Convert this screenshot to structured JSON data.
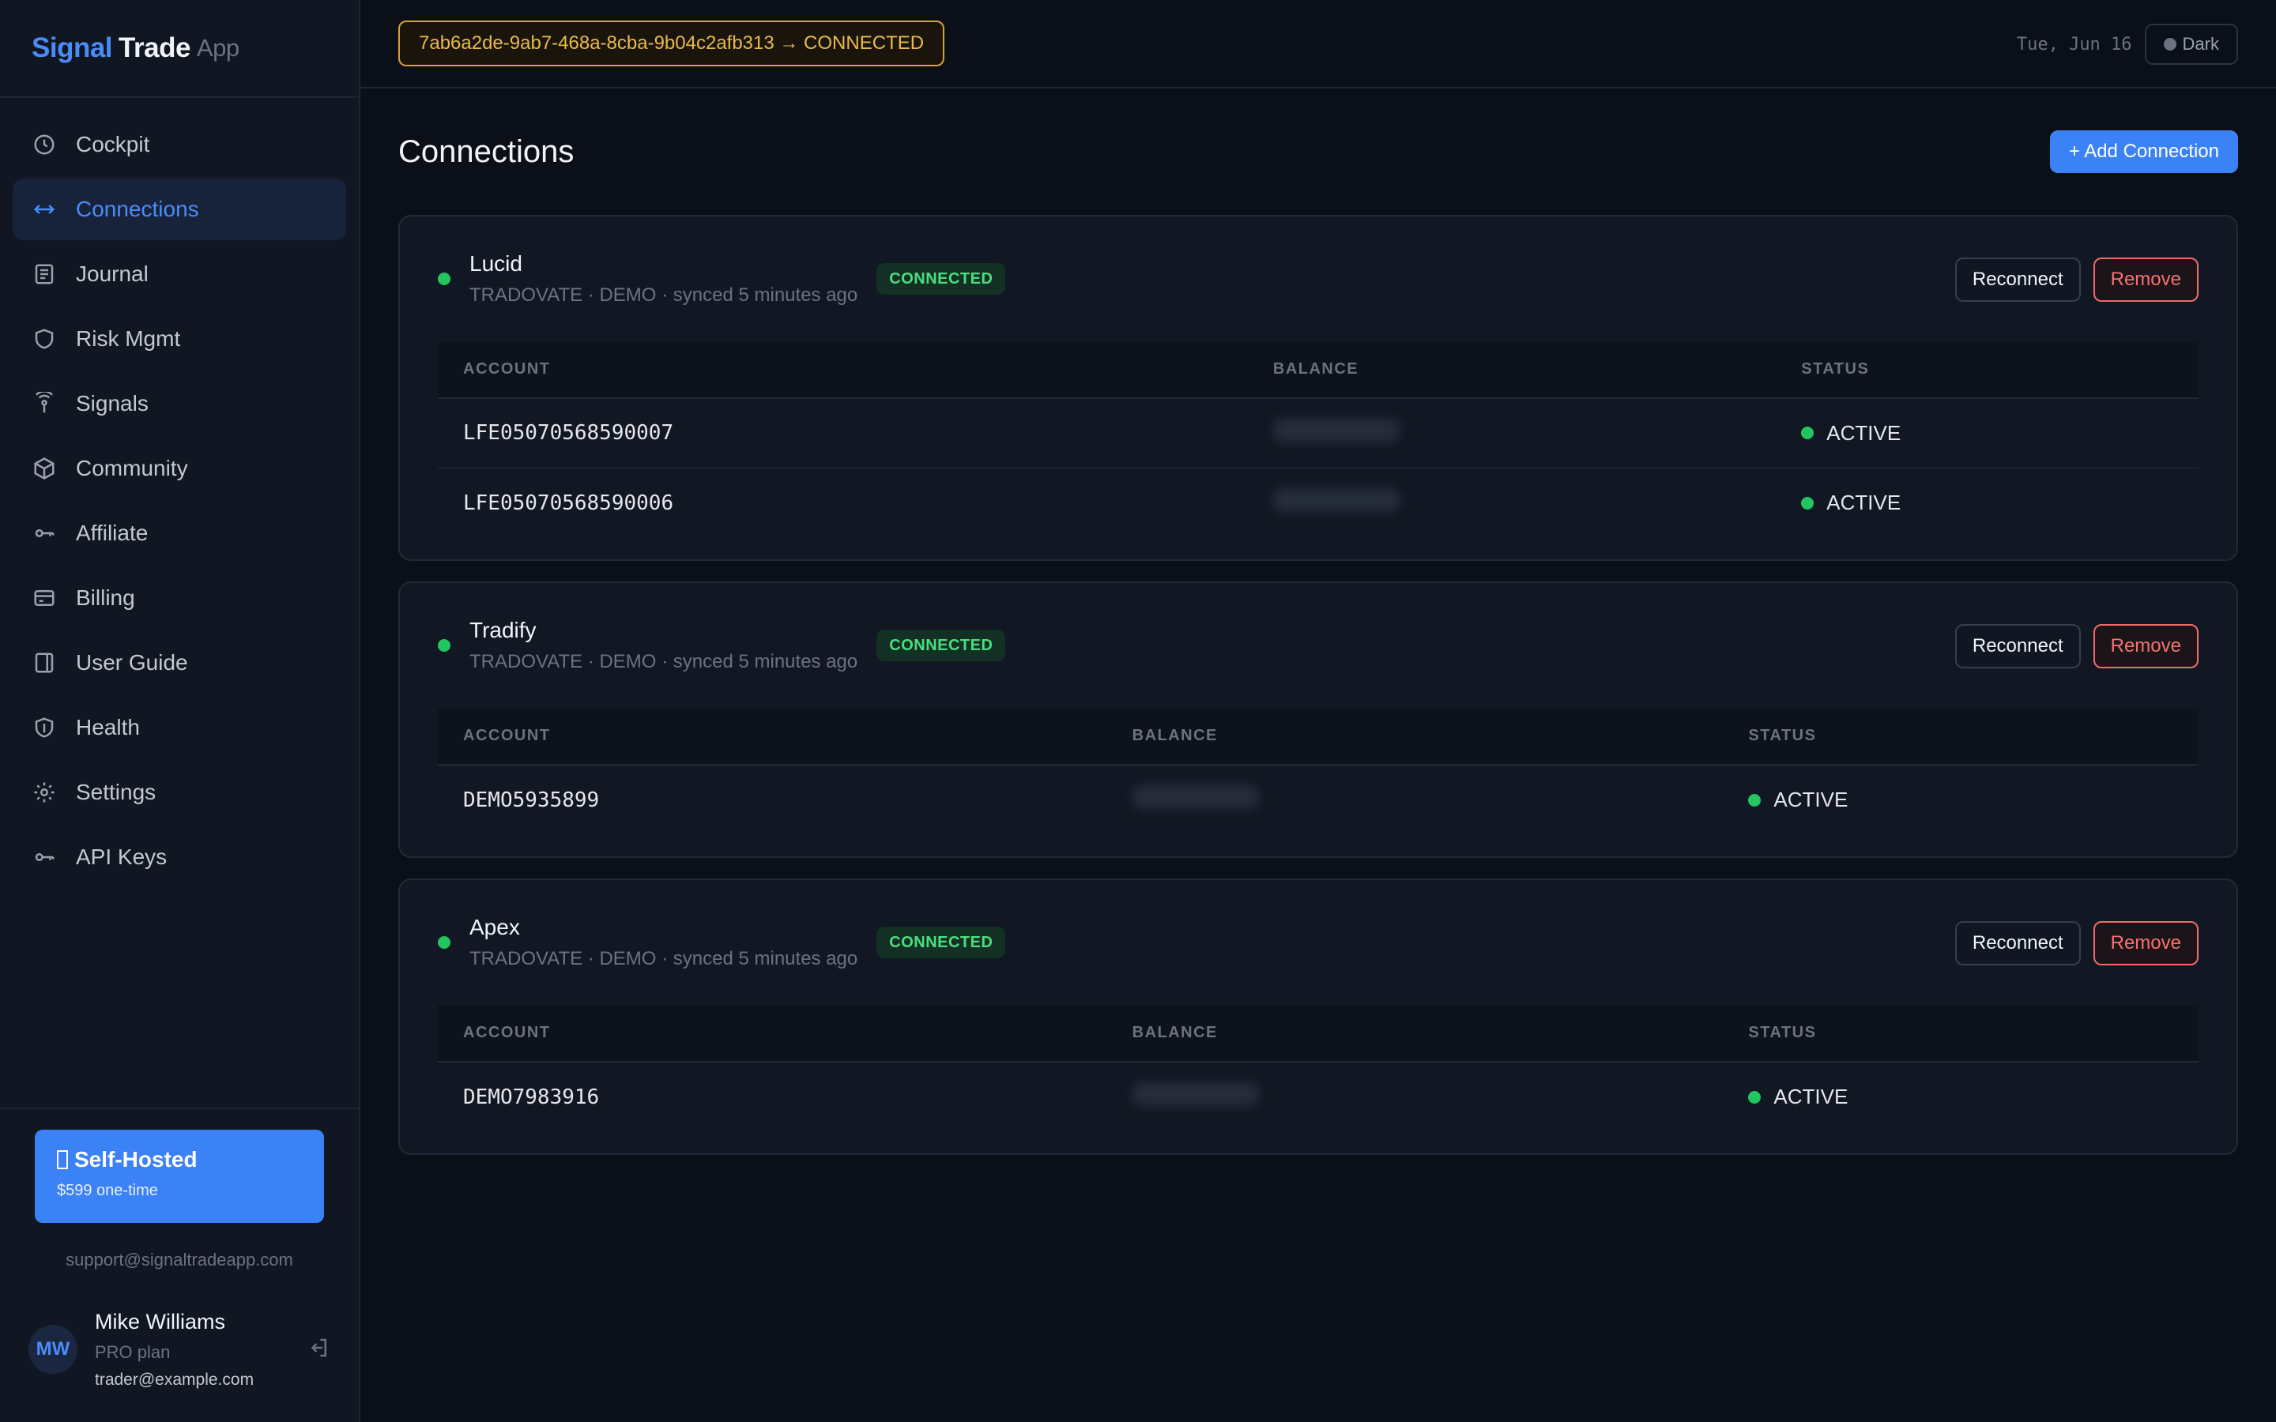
{
  "brand": {
    "part1": "Signal",
    "part2": "Trade",
    "part3": "App"
  },
  "sidebar": {
    "items": [
      {
        "label": "Cockpit",
        "icon": "clock-icon",
        "active": false
      },
      {
        "label": "Connections",
        "icon": "arrows-horizontal-icon",
        "active": true
      },
      {
        "label": "Journal",
        "icon": "journal-icon",
        "active": false
      },
      {
        "label": "Risk Mgmt",
        "icon": "shield-icon",
        "active": false
      },
      {
        "label": "Signals",
        "icon": "broadcast-icon",
        "active": false
      },
      {
        "label": "Community",
        "icon": "cube-icon",
        "active": false
      },
      {
        "label": "Affiliate",
        "icon": "key-icon",
        "active": false
      },
      {
        "label": "Billing",
        "icon": "credit-card-icon",
        "active": false
      },
      {
        "label": "User Guide",
        "icon": "book-icon",
        "active": false
      },
      {
        "label": "Health",
        "icon": "shield-heart-icon",
        "active": false
      },
      {
        "label": "Settings",
        "icon": "gear-icon",
        "active": false
      },
      {
        "label": "API Keys",
        "icon": "key-icon",
        "active": false
      }
    ],
    "promo": {
      "title": "Self-Hosted",
      "price": "$599 one-time"
    },
    "support_email": "support@signaltradeapp.com",
    "user": {
      "initials": "MW",
      "name": "Mike Williams",
      "plan": "PRO plan",
      "email": "trader@example.com"
    }
  },
  "topbar": {
    "connection_status": "7ab6a2de-9ab7-468a-8cba-9b04c2afb313 → CONNECTED",
    "date": "Tue, Jun 16",
    "theme_label": "Dark"
  },
  "page": {
    "title": "Connections",
    "add_button": "+ Add Connection"
  },
  "connections": [
    {
      "name": "Lucid",
      "meta": "TRADOVATE · DEMO · synced 5 minutes ago",
      "badge": "CONNECTED",
      "reconnect": "Reconnect",
      "remove": "Remove",
      "headers": [
        "ACCOUNT",
        "BALANCE",
        "STATUS"
      ],
      "accounts": [
        {
          "account": "LFE05070568590007",
          "status": "ACTIVE"
        },
        {
          "account": "LFE05070568590006",
          "status": "ACTIVE"
        }
      ]
    },
    {
      "name": "Tradify",
      "meta": "TRADOVATE · DEMO · synced 5 minutes ago",
      "badge": "CONNECTED",
      "reconnect": "Reconnect",
      "remove": "Remove",
      "headers": [
        "ACCOUNT",
        "BALANCE",
        "STATUS"
      ],
      "accounts": [
        {
          "account": "DEMO5935899",
          "status": "ACTIVE"
        }
      ]
    },
    {
      "name": "Apex",
      "meta": "TRADOVATE · DEMO · synced 5 minutes ago",
      "badge": "CONNECTED",
      "reconnect": "Reconnect",
      "remove": "Remove",
      "headers": [
        "ACCOUNT",
        "BALANCE",
        "STATUS"
      ],
      "accounts": [
        {
          "account": "DEMO7983916",
          "status": "ACTIVE"
        }
      ]
    }
  ],
  "colors": {
    "accent": "#3b82f6",
    "success": "#22c55e",
    "warning": "#e9b94f",
    "danger": "#f87171"
  }
}
